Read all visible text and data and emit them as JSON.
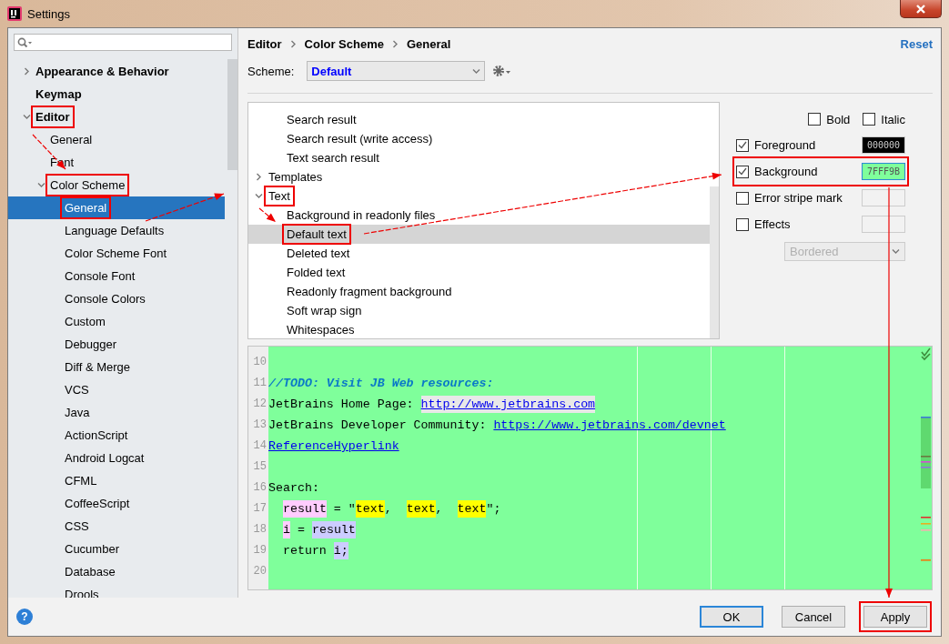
{
  "window": {
    "title": "Settings"
  },
  "sidebar": {
    "items": [
      {
        "label": "Appearance & Behavior",
        "expanded": false,
        "selected": false,
        "annotated": false
      },
      {
        "label": "Keymap",
        "selected": false,
        "annotated": false
      },
      {
        "label": "Editor",
        "expanded": true,
        "selected": false,
        "annotated": true,
        "children": [
          {
            "label": "General",
            "selected": false,
            "annotated": false
          },
          {
            "label": "Font",
            "selected": false,
            "annotated": false
          },
          {
            "label": "Color Scheme",
            "expanded": true,
            "selected": false,
            "annotated": true,
            "children": [
              {
                "label": "General",
                "selected": true,
                "annotated": true
              },
              {
                "label": "Language Defaults",
                "selected": false,
                "annotated": false
              },
              {
                "label": "Color Scheme Font",
                "selected": false,
                "annotated": false
              },
              {
                "label": "Console Font",
                "selected": false,
                "annotated": false
              },
              {
                "label": "Console Colors",
                "selected": false,
                "annotated": false
              },
              {
                "label": "Custom",
                "selected": false,
                "annotated": false
              },
              {
                "label": "Debugger",
                "selected": false,
                "annotated": false
              },
              {
                "label": "Diff & Merge",
                "selected": false,
                "annotated": false
              },
              {
                "label": "VCS",
                "selected": false,
                "annotated": false
              },
              {
                "label": "Java",
                "selected": false,
                "annotated": false
              },
              {
                "label": "ActionScript",
                "selected": false,
                "annotated": false
              },
              {
                "label": "Android Logcat",
                "selected": false,
                "annotated": false
              },
              {
                "label": "CFML",
                "selected": false,
                "annotated": false
              },
              {
                "label": "CoffeeScript",
                "selected": false,
                "annotated": false
              },
              {
                "label": "CSS",
                "selected": false,
                "annotated": false
              },
              {
                "label": "Cucumber",
                "selected": false,
                "annotated": false
              },
              {
                "label": "Database",
                "selected": false,
                "annotated": false
              },
              {
                "label": "Drools",
                "selected": false,
                "annotated": false
              }
            ]
          }
        ]
      }
    ]
  },
  "breadcrumb": [
    "Editor",
    "Color Scheme",
    "General"
  ],
  "reset_link": "Reset",
  "scheme": {
    "label": "Scheme:",
    "value": "Default"
  },
  "element_tree": [
    {
      "children": [
        {
          "label": "Search result",
          "selected": false,
          "annotated": false
        },
        {
          "label": "Search result (write access)",
          "selected": false,
          "annotated": false
        },
        {
          "label": "Text search result",
          "selected": false,
          "annotated": false
        }
      ]
    },
    {
      "label": "Templates",
      "expanded": false,
      "selected": false,
      "annotated": false
    },
    {
      "label": "Text",
      "expanded": true,
      "selected": false,
      "annotated": true,
      "children": [
        {
          "label": "Background in readonly files",
          "selected": false,
          "annotated": false
        },
        {
          "label": "Default text",
          "selected": true,
          "annotated": true
        },
        {
          "label": "Deleted text",
          "selected": false,
          "annotated": false
        },
        {
          "label": "Folded text",
          "selected": false,
          "annotated": false
        },
        {
          "label": "Readonly fragment background",
          "selected": false,
          "annotated": false
        },
        {
          "label": "Soft wrap sign",
          "selected": false,
          "annotated": false
        },
        {
          "label": "Whitespaces",
          "selected": false,
          "annotated": false
        }
      ]
    }
  ],
  "font_style": [
    {
      "label": "Bold",
      "checked": false
    },
    {
      "label": "Italic",
      "checked": false
    }
  ],
  "attributes": [
    {
      "label": "Foreground",
      "checked": true,
      "value": "000000",
      "color": "#000000",
      "annotated": false
    },
    {
      "label": "Background",
      "checked": true,
      "value": "7FFF9B",
      "color": "#7fff9b",
      "annotated": true
    },
    {
      "label": "Error stripe mark",
      "checked": false,
      "annotated": false
    },
    {
      "label": "Effects",
      "checked": false,
      "annotated": false
    }
  ],
  "effect_type": {
    "value": "Bordered",
    "disabled": true
  },
  "preview": {
    "lines": [
      {
        "number": "10"
      },
      {
        "number": "11",
        "segments": [
          {
            "text": "//TODO: Visit JB Web resources:",
            "kind": "comment"
          }
        ]
      },
      {
        "number": "12",
        "segments": [
          {
            "text": "JetBrains Home Page: ",
            "kind": "plain"
          },
          {
            "text": "http://www.jetbrains.com",
            "kind": "hovered-link"
          }
        ]
      },
      {
        "number": "13",
        "segments": [
          {
            "text": "JetBrains Developer Community: ",
            "kind": "plain"
          },
          {
            "text": "https://www.jetbrains.com/devnet",
            "kind": "link"
          }
        ]
      },
      {
        "number": "14",
        "segments": [
          {
            "text": "ReferenceHyperlink",
            "kind": "link"
          }
        ]
      },
      {
        "number": "15"
      },
      {
        "number": "16",
        "segments": [
          {
            "text": "Search:",
            "kind": "plain"
          }
        ]
      },
      {
        "number": "17",
        "indented": true,
        "segments": [
          {
            "text": "result",
            "kind": "write"
          },
          {
            "text": " = \"",
            "kind": "plain"
          },
          {
            "text": "text",
            "kind": "match"
          },
          {
            "text": ",  ",
            "kind": "plain"
          },
          {
            "text": "text",
            "kind": "match"
          },
          {
            "text": ",  ",
            "kind": "plain"
          },
          {
            "text": "text",
            "kind": "match"
          },
          {
            "text": "\";",
            "kind": "plain"
          }
        ]
      },
      {
        "number": "18",
        "indented": true,
        "segments": [
          {
            "text": "i",
            "kind": "write"
          },
          {
            "text": " = ",
            "kind": "plain"
          },
          {
            "text": "result",
            "kind": "read"
          }
        ]
      },
      {
        "number": "19",
        "segments": [
          {
            "text": "  return ",
            "kind": "plain"
          },
          {
            "text": "i;",
            "kind": "read"
          }
        ]
      },
      {
        "number": "20"
      }
    ]
  },
  "help_button": "?",
  "buttons": [
    {
      "label": "OK",
      "default": true,
      "annotated": false
    },
    {
      "label": "Cancel",
      "default": false,
      "annotated": false
    },
    {
      "label": "Apply",
      "default": false,
      "annotated": true
    }
  ]
}
